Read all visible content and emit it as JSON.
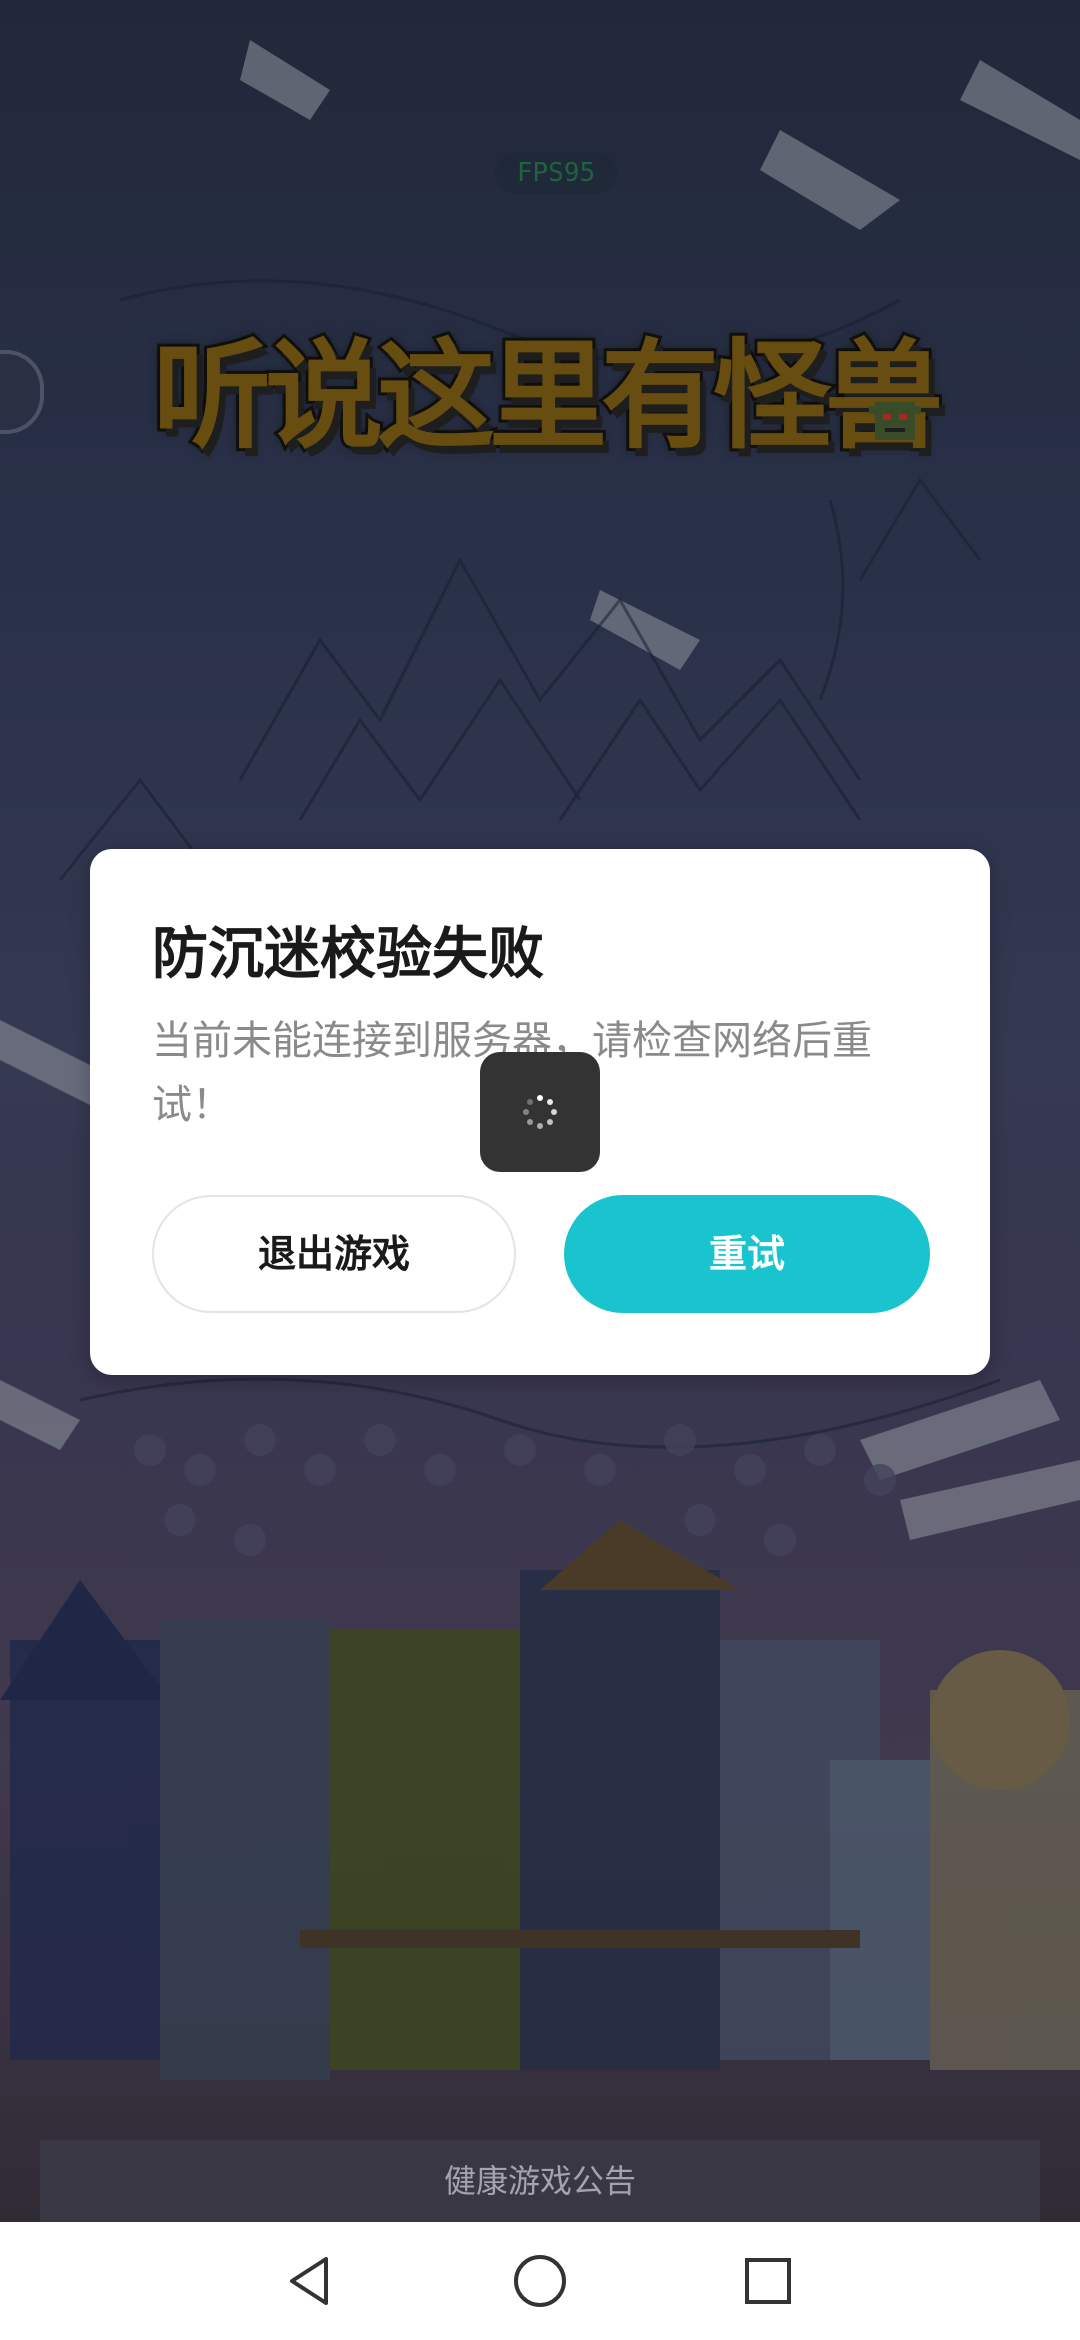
{
  "status": {
    "fps_label": "FPS95"
  },
  "game": {
    "title": "听说这里有怪兽"
  },
  "dialog": {
    "title": "防沉迷校验失败",
    "message": "当前未能连接到服务器，请检查网络后重试！",
    "exit_label": "退出游戏",
    "retry_label": "重试",
    "accent_color": "#19c4cf"
  },
  "footer": {
    "announcement": "健康游戏公告"
  },
  "nav": {
    "back_icon": "triangle-back-icon",
    "home_icon": "circle-home-icon",
    "recents_icon": "square-recents-icon"
  }
}
